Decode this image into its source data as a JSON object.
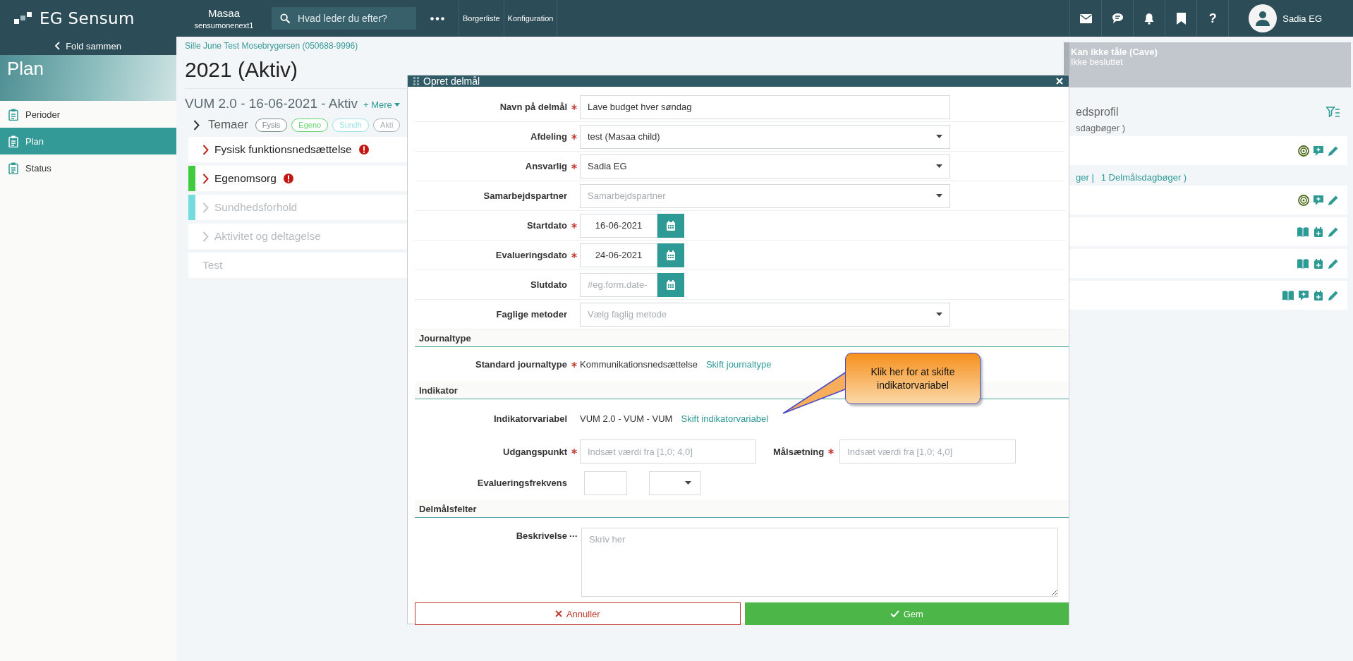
{
  "top_bar": {
    "logo": "EG Sensum",
    "org": {
      "name": "Masaa",
      "sub": "sensumonenext1"
    },
    "search": {
      "placeholder": "Hvad leder du efter?"
    },
    "nav": [
      "Borgerliste",
      "Konfiguration"
    ],
    "help": "?",
    "user": "Sadia EG"
  },
  "sidebar": {
    "collapse": "Fold sammen",
    "title": "Plan",
    "items": [
      {
        "label": "Perioder",
        "selected": false
      },
      {
        "label": "Plan",
        "selected": true
      },
      {
        "label": "Status",
        "selected": false
      }
    ]
  },
  "main": {
    "patient": "Sille June Test Mosebrygersen (050688-9996)",
    "title": "2021 (Aktiv)",
    "subtitle": "VUM 2.0 - 16-06-2021 - Aktiv",
    "more": "+ Mere",
    "themes_label": "Temaer",
    "chips": [
      {
        "label": "Fysis",
        "color": "#7d8c92"
      },
      {
        "label": "Egeno",
        "color": "#62d36b"
      },
      {
        "label": "Sundh",
        "color": "#9ee2e6"
      },
      {
        "label": "Akti",
        "color": "#a9b1b6"
      }
    ],
    "themes": [
      {
        "kind": "theme",
        "label": "Fysisk funktionsnedsættelse",
        "disabled": false,
        "alert": true
      },
      {
        "kind": "theme",
        "label": "Egenomsorg",
        "disabled": false,
        "alert": true,
        "color": "#3fca3f"
      },
      {
        "kind": "theme",
        "label": "Sundhedsforhold",
        "disabled": true,
        "alert": false,
        "color": "#74dcdc"
      },
      {
        "kind": "theme",
        "label": "Aktivitet og deltagelse",
        "disabled": true,
        "alert": false
      },
      {
        "kind": "note",
        "label": "Test",
        "disabled": true,
        "alert": false
      }
    ]
  },
  "right_panel": {
    "cave": {
      "title": "Kan ikke tåle (Cave)",
      "status": "Ikke besluttet"
    },
    "heading": "edsprofil",
    "groups": [
      {
        "summary": [
          {
            "kind": "text",
            "text": "sdagbøger )"
          }
        ],
        "cards": [
          {
            "kind": "goal"
          }
        ]
      },
      {
        "summary": [
          {
            "kind": "link",
            "text": "ger |"
          },
          {
            "kind": "link",
            "text": "1 Delmålsdagbøger )"
          }
        ],
        "cards": [
          {
            "kind": "goal"
          },
          {
            "kind": "journal"
          },
          {
            "kind": "journal"
          },
          {
            "kind": "journal-full"
          }
        ]
      }
    ]
  },
  "dialog": {
    "title": "Opret delmål",
    "fields": [
      {
        "kind": "text",
        "label": "Navn på delmål",
        "required": true,
        "value": "Lave budget hver søndag"
      },
      {
        "kind": "select",
        "label": "Afdeling",
        "required": true,
        "value": "test (Masaa child)"
      },
      {
        "kind": "select",
        "label": "Ansvarlig",
        "required": true,
        "value": "Sadia EG"
      },
      {
        "kind": "select",
        "label": "Samarbejdspartner",
        "required": false,
        "placeholder": "Samarbejdspartner"
      },
      {
        "kind": "date",
        "label": "Startdato",
        "required": true,
        "value": "16-06-2021"
      },
      {
        "kind": "date",
        "label": "Evalueringsdato",
        "required": true,
        "value": "24-06-2021"
      },
      {
        "kind": "date",
        "label": "Slutdato",
        "required": false,
        "placeholder": "#eg.form.date-"
      },
      {
        "kind": "select",
        "label": "Faglige metoder",
        "required": false,
        "placeholder": "Vælg faglig metode"
      }
    ],
    "journal": {
      "heading": "Journaltype",
      "label": "Standard journaltype",
      "required": true,
      "value": "Kommunikationsnedsættelse",
      "link": "Skift journaltype"
    },
    "indicator": {
      "heading": "Indikator",
      "label": "Indikatorvariabel",
      "value": "VUM 2.0 - VUM - VUM",
      "link": "Skift indikatorvariabel",
      "start": {
        "label": "Udgangspunkt",
        "required": true,
        "placeholder": "Indsæt værdi fra [1,0; 4,0]"
      },
      "goal": {
        "label": "Målsætning",
        "required": true,
        "placeholder": "Indsæt værdi fra [1,0; 4,0]"
      },
      "frequency": {
        "label": "Evalueringsfrekvens"
      }
    },
    "fields_section": {
      "heading": "Delmålsfelter",
      "label": "Beskrivelse",
      "more": "···",
      "placeholder": "Skriv her"
    },
    "buttons": {
      "cancel": "Annuller",
      "save": "Gem"
    }
  },
  "callout": {
    "text": "Klik her for at skifte indikatorvariabel"
  }
}
